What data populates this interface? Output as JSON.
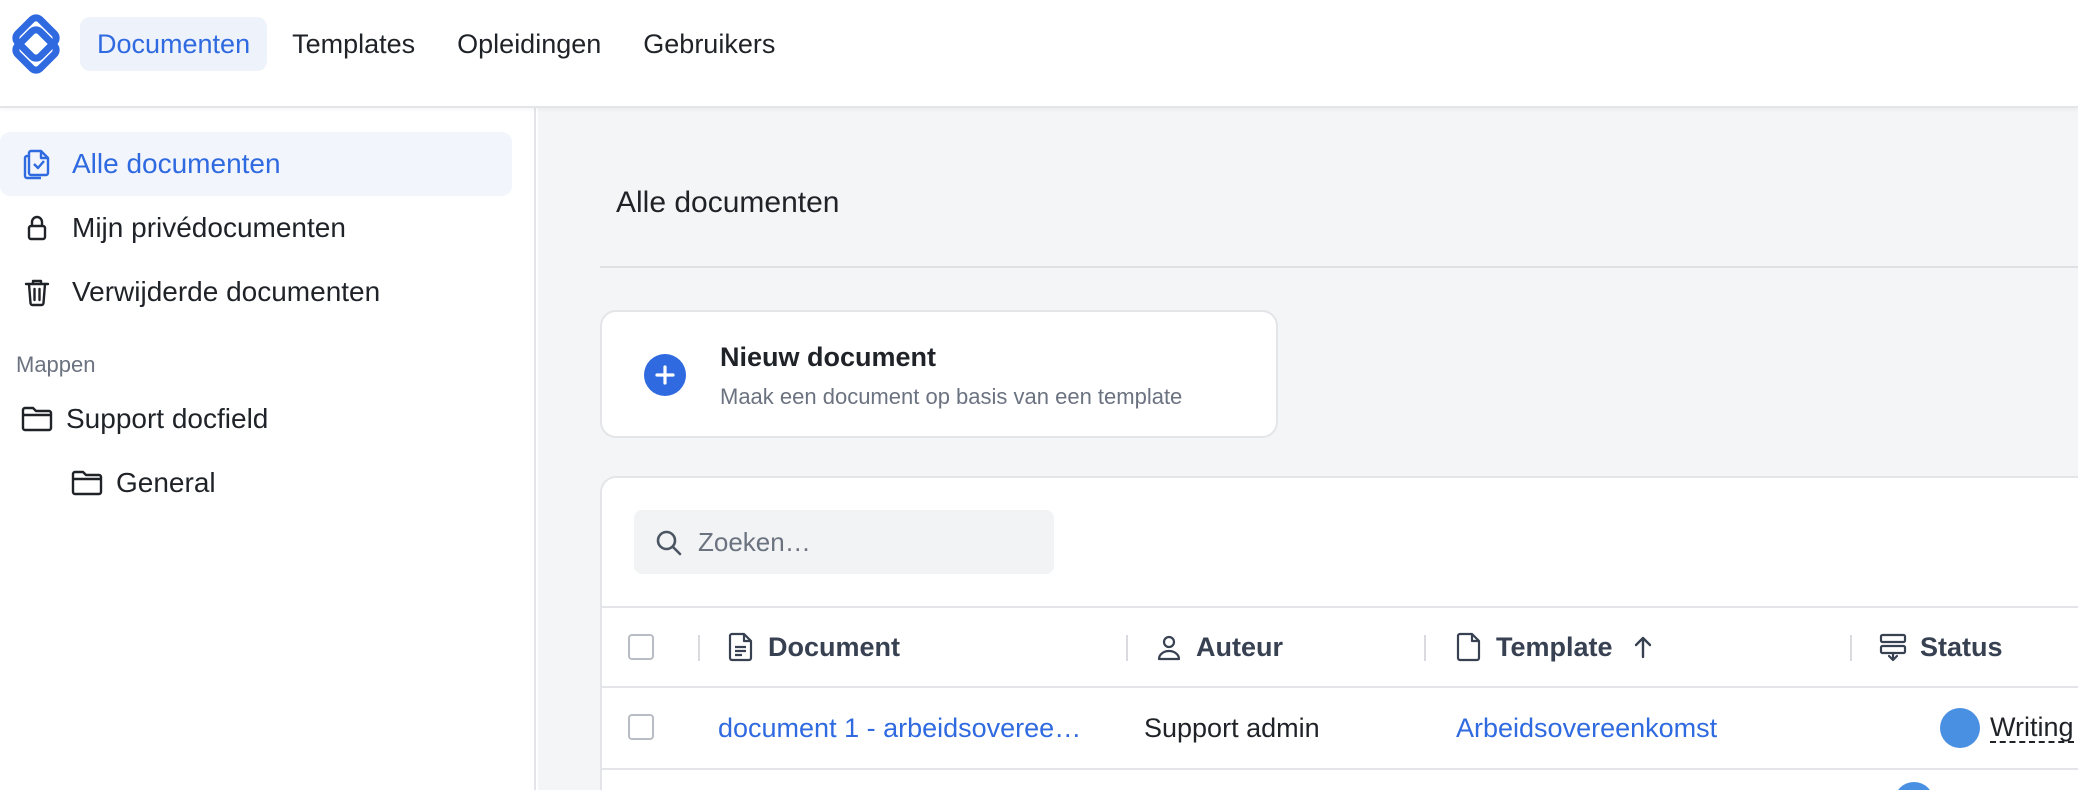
{
  "nav": {
    "items": [
      {
        "label": "Documenten",
        "active": true
      },
      {
        "label": "Templates",
        "active": false
      },
      {
        "label": "Opleidingen",
        "active": false
      },
      {
        "label": "Gebruikers",
        "active": false
      }
    ]
  },
  "sidebar": {
    "items": [
      {
        "label": "Alle documenten",
        "icon": "documents-icon",
        "active": true
      },
      {
        "label": "Mijn privédocumenten",
        "icon": "lock-icon",
        "active": false
      },
      {
        "label": "Verwijderde documenten",
        "icon": "trash-icon",
        "active": false
      }
    ],
    "section_title": "Mappen",
    "folders": [
      {
        "label": "Support docfield",
        "icon": "folder-icon"
      },
      {
        "label": "General",
        "icon": "folder-icon"
      }
    ]
  },
  "main": {
    "title": "Alle documenten",
    "new_document": {
      "title": "Nieuw document",
      "subtitle": "Maak een document op basis van een template"
    },
    "search": {
      "placeholder": "Zoeken…"
    },
    "table": {
      "columns": [
        {
          "label": "Document",
          "icon": "file-text-icon"
        },
        {
          "label": "Auteur",
          "icon": "user-icon"
        },
        {
          "label": "Template",
          "icon": "file-icon",
          "sort": "ascending"
        },
        {
          "label": "Status",
          "icon": "status-icon"
        }
      ],
      "rows": [
        {
          "document": "document 1 - arbeidsoveree…",
          "author": "Support admin",
          "template": "Arbeidsovereenkomst",
          "status": "Writing"
        }
      ]
    }
  },
  "colors": {
    "accent": "#2f6ae0",
    "status_writing": "#4a90e2",
    "main_background": "#f4f5f6"
  }
}
